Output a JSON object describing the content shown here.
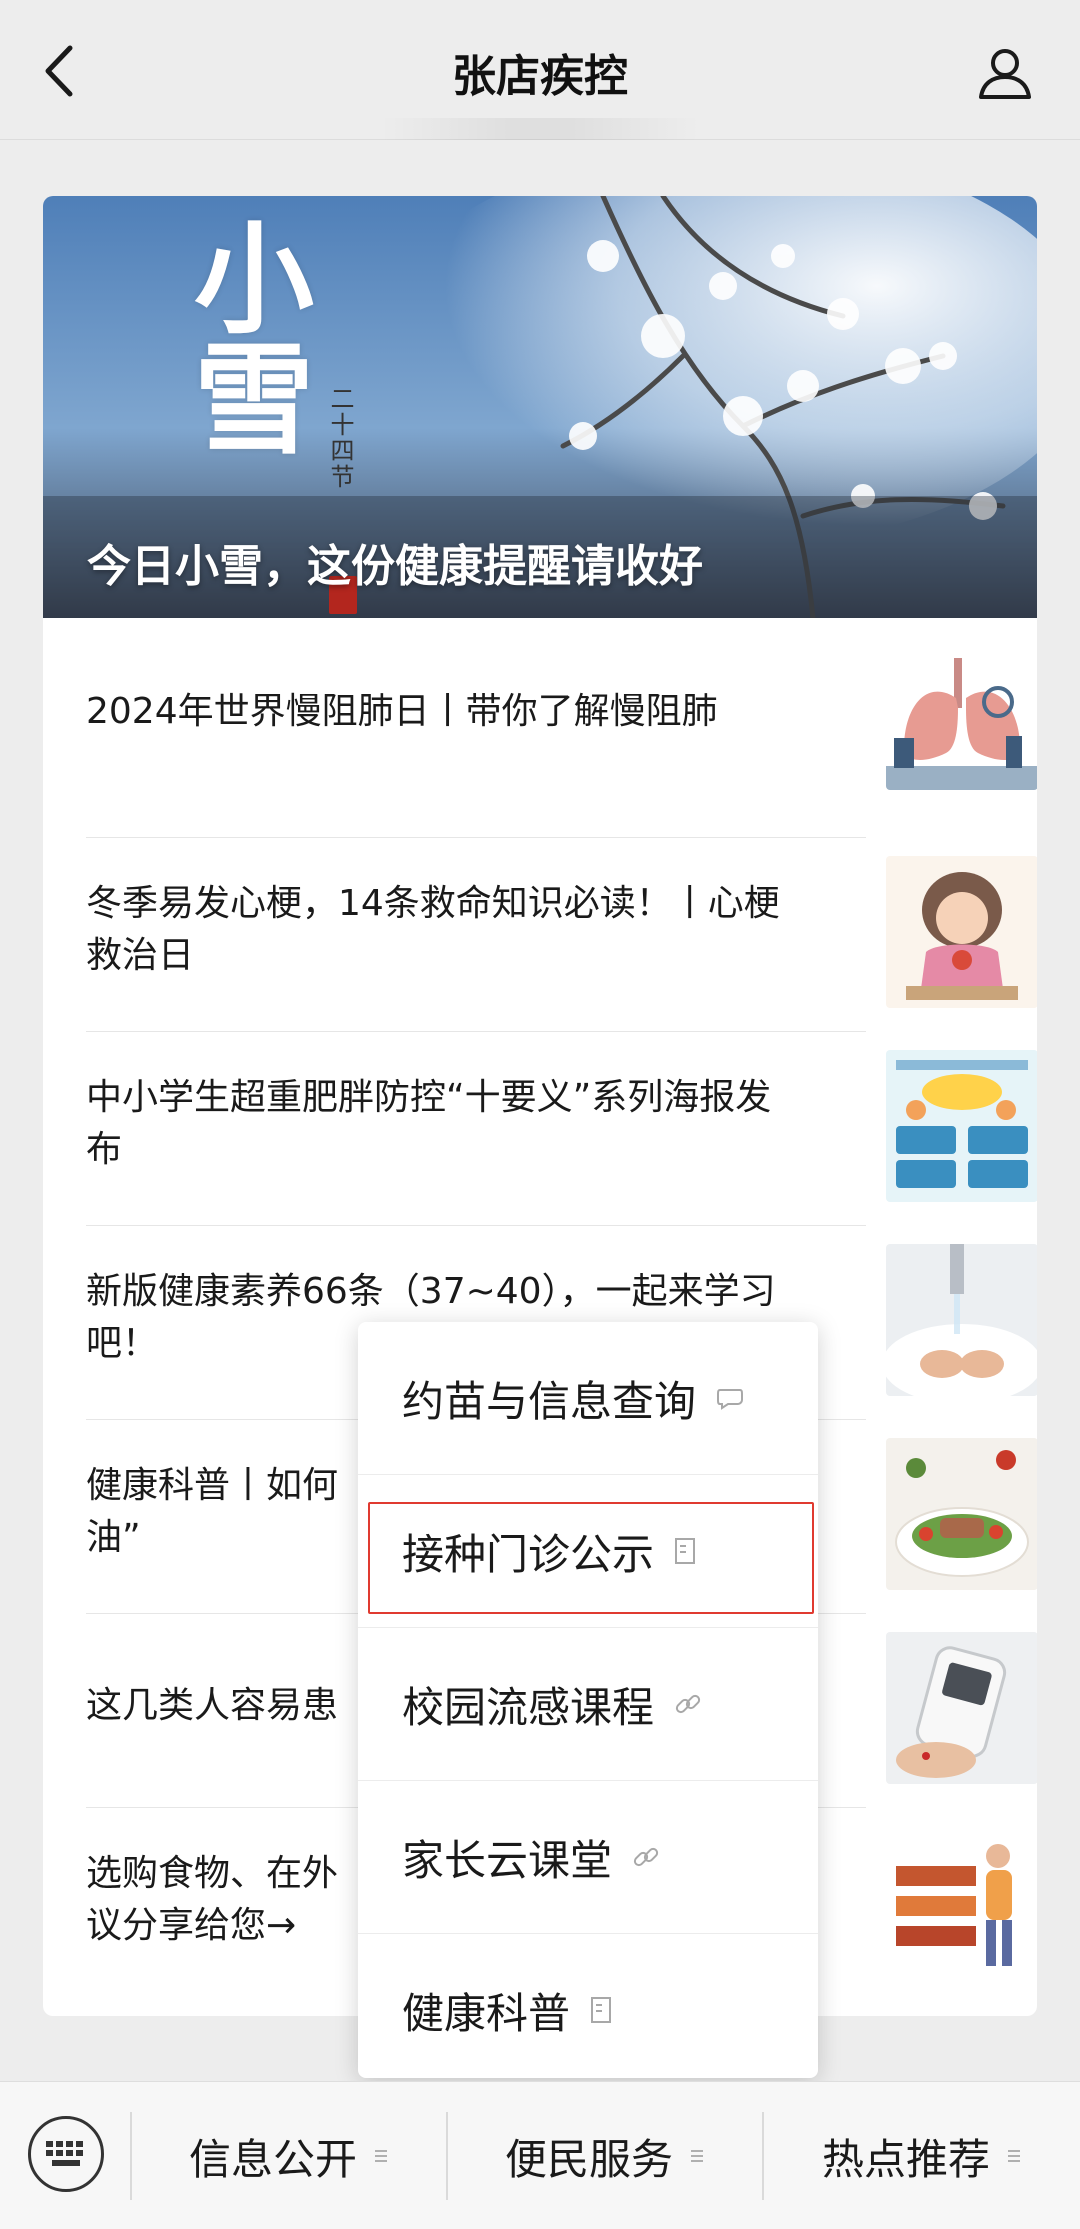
{
  "header": {
    "title": "张店疾控",
    "back_icon": "chevron-left-icon",
    "profile_icon": "user-icon"
  },
  "hero": {
    "title": "今日小雪，这份健康提醒请收好",
    "art_big": "小雪",
    "art_small": "二十四节"
  },
  "articles": [
    {
      "title": "2024年世界慢阻肺日丨带你了解慢阻肺",
      "thumb": "lungs-illustration"
    },
    {
      "title": "冬季易发心梗，14条救命知识必读！丨心梗救治日",
      "thumb": "girl-illustration"
    },
    {
      "title": "中小学生超重肥胖防控“十要义”系列海报发布",
      "thumb": "poster-illustration"
    },
    {
      "title": "新版健康素养66条（37~40），一起来学习吧！",
      "thumb": "handwash-photo"
    },
    {
      "title": "健康科普丨如何",
      "title_tail": "油”",
      "thumb": "salad-photo"
    },
    {
      "title": "这几类人容易患",
      "thumb": "glucose-meter-photo"
    },
    {
      "title": "选购食物、在外",
      "title_tail": "议分享给您→",
      "thumb": "market-illustration"
    }
  ],
  "popup_menu": {
    "items": [
      {
        "label": "约苗与信息查询",
        "icon": "chat-bubble-icon"
      },
      {
        "label": "接种门诊公示",
        "icon": "document-icon",
        "highlighted": true
      },
      {
        "label": "校园流感课程",
        "icon": "link-icon"
      },
      {
        "label": "家长云课堂",
        "icon": "link-icon"
      },
      {
        "label": "健康科普",
        "icon": "document-icon"
      }
    ]
  },
  "bottom_bar": {
    "keyboard_icon": "keyboard-icon",
    "tabs": [
      {
        "label": "信息公开"
      },
      {
        "label": "便民服务"
      },
      {
        "label": "热点推荐"
      }
    ]
  },
  "colors": {
    "background": "#ededed",
    "card": "#ffffff",
    "highlight_border": "#e03a30"
  }
}
